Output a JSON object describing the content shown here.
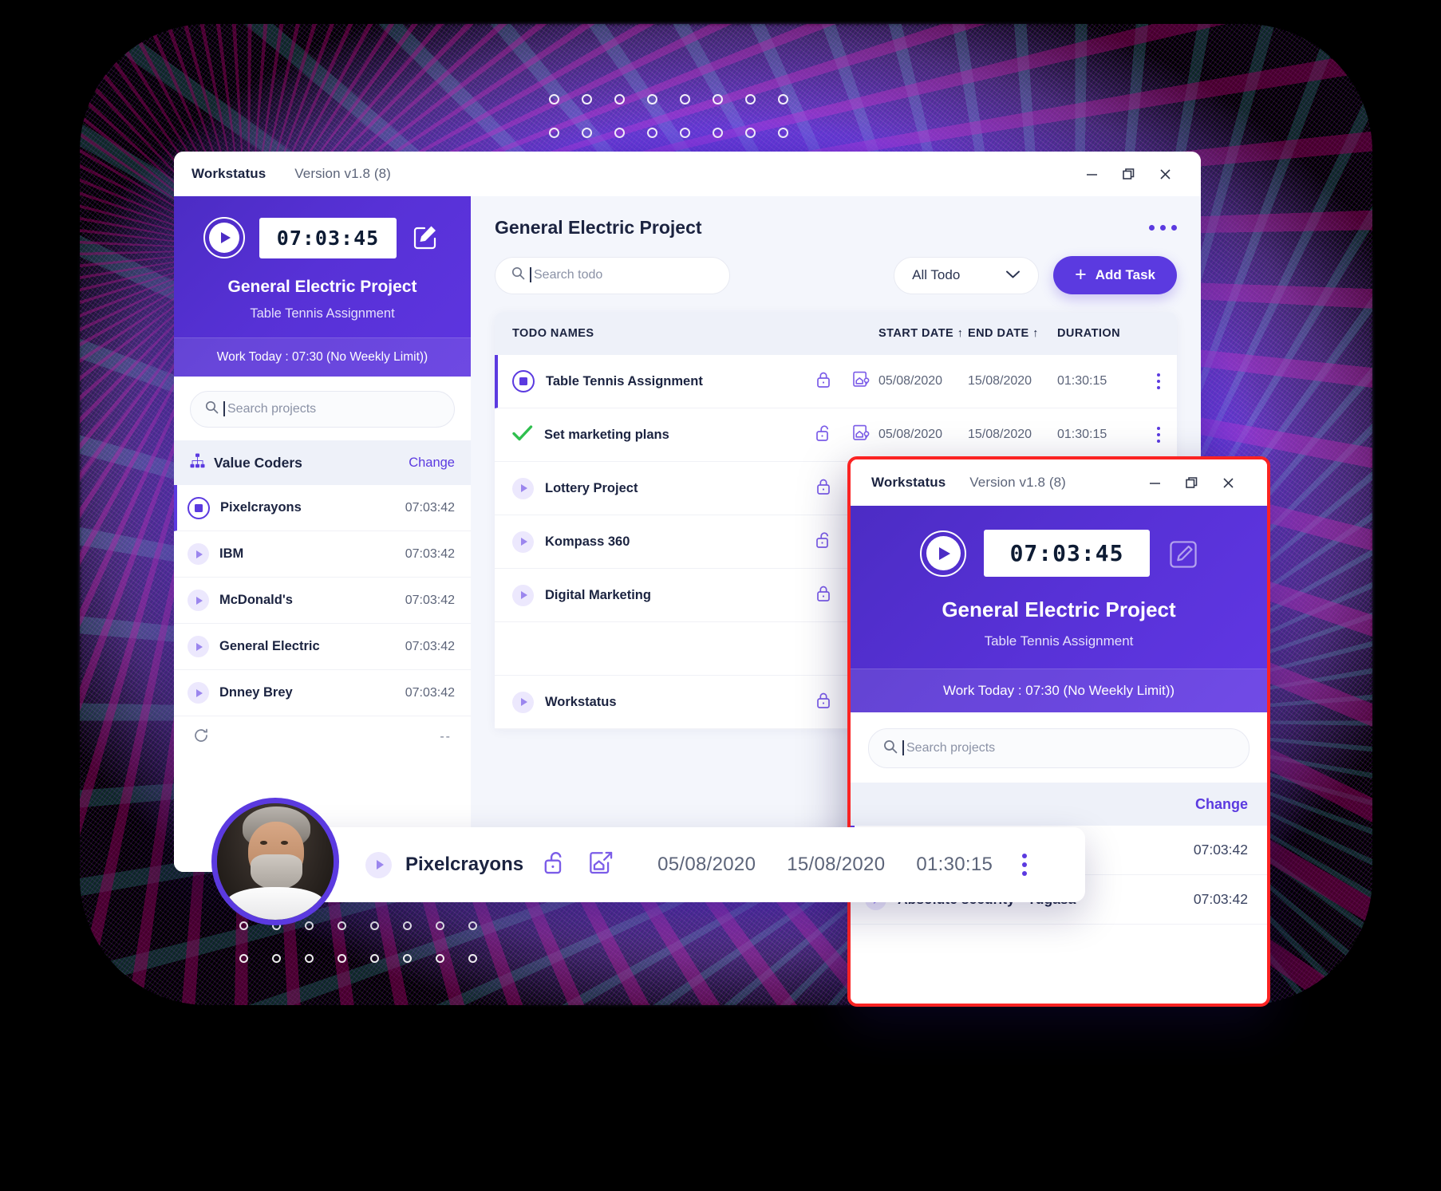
{
  "app": {
    "name": "Workstatus",
    "version": "Version v1.8 (8)"
  },
  "window_controls": {
    "minimize": "minimize-icon",
    "maximize": "restore-icon",
    "close": "close-icon"
  },
  "sidebar": {
    "timer": "07:03:45",
    "play_icon": "play-icon",
    "edit_icon": "edit-pencil-icon",
    "project_title": "General Electric Project",
    "task_subtitle": "Table Tennis Assignment",
    "work_today": "Work Today : 07:30 (No Weekly Limit))",
    "search_placeholder": "Search projects",
    "search_value": "",
    "group": {
      "icon": "org-chart-icon",
      "name": "Value Coders",
      "change_label": "Change"
    },
    "projects": [
      {
        "name": "Pixelcrayons",
        "time": "07:03:42",
        "state": "running",
        "icon": "stop-square-icon"
      },
      {
        "name": "IBM",
        "time": "07:03:42",
        "state": "idle",
        "icon": "play-icon"
      },
      {
        "name": "McDonald's",
        "time": "07:03:42",
        "state": "idle",
        "icon": "play-icon"
      },
      {
        "name": "General Electric",
        "time": "07:03:42",
        "state": "idle",
        "icon": "play-icon"
      },
      {
        "name": "Dnney Brey",
        "time": "07:03:42",
        "state": "idle",
        "icon": "play-icon"
      }
    ]
  },
  "content": {
    "page_title": "General Electric Project",
    "overflow_icon": "more-horizontal-icon",
    "search_placeholder": "Search todo",
    "search_value": "",
    "filter_selected": "All Todo",
    "filter_icon": "chevron-down-icon",
    "add_task_label": "Add Task",
    "add_task_icon": "plus-icon",
    "table": {
      "columns": [
        "TODO NAMES",
        "START DATE ↑",
        "END DATE ↑",
        "DURATION"
      ],
      "rows": [
        {
          "name": "Table Tennis Assignment",
          "status": "running",
          "status_icon": "stop-square-icon",
          "lock": "lock-closed-icon",
          "place": "house-pin-icon",
          "start": "05/08/2020",
          "end": "15/08/2020",
          "duration": "01:30:15",
          "menu": "kebab-menu-icon",
          "selected": true
        },
        {
          "name": "Set marketing plans",
          "status": "done",
          "status_icon": "check-icon",
          "lock": "lock-open-icon",
          "place": "house-pin-icon",
          "start": "05/08/2020",
          "end": "15/08/2020",
          "duration": "01:30:15",
          "menu": "kebab-menu-icon",
          "selected": false
        },
        {
          "name": "Lottery Project",
          "status": "idle",
          "status_icon": "play-icon",
          "lock": "lock-closed-icon",
          "place": "house-arrow-icon",
          "start": "",
          "end": "",
          "duration": "",
          "menu": "",
          "selected": false
        },
        {
          "name": "Kompass 360",
          "status": "idle",
          "status_icon": "play-icon",
          "lock": "lock-open-icon",
          "place": "house-pin-icon",
          "start": "",
          "end": "",
          "duration": "",
          "menu": "",
          "selected": false
        },
        {
          "name": "Digital Marketing",
          "status": "idle",
          "status_icon": "play-icon",
          "lock": "lock-closed-icon",
          "place": "house-arrow-icon",
          "start": "",
          "end": "",
          "duration": "",
          "menu": "",
          "selected": false
        },
        {
          "name": "",
          "status": "",
          "status_icon": "",
          "lock": "",
          "place": "",
          "start": "",
          "end": "",
          "duration": "",
          "menu": "",
          "selected": false
        },
        {
          "name": "Workstatus",
          "status": "idle",
          "status_icon": "play-icon",
          "lock": "lock-closed-icon",
          "place": "house-pin-icon",
          "start": "",
          "end": "",
          "duration": "",
          "menu": "",
          "selected": false
        }
      ]
    }
  },
  "mini_window": {
    "app_name": "Workstatus",
    "version": "Version v1.8 (8)",
    "timer": "07:03:45",
    "project_title": "General Electric Project",
    "task_subtitle": "Table Tennis Assignment",
    "work_today": "Work Today : 07:30 (No Weekly Limit))",
    "search_placeholder": "Search projects",
    "search_value": "",
    "change_label": "Change",
    "projects": [
      {
        "name": "",
        "time": "07:03:42",
        "state": "running"
      },
      {
        "name": "Absolute security - Yugasa",
        "time": "07:03:42",
        "state": "idle"
      }
    ]
  },
  "float_row": {
    "name": "Pixelcrayons",
    "play_icon": "play-icon",
    "lock_icon": "lock-open-icon",
    "place_icon": "house-arrow-icon",
    "start": "05/08/2020",
    "end": "15/08/2020",
    "duration": "01:30:15",
    "menu_icon": "kebab-menu-icon",
    "avatar": "user-avatar-photo"
  },
  "colors": {
    "brand_purple": "#5b3ae0",
    "hero_purple": "#4c2cc4",
    "accent_red": "#fb2323",
    "success_green": "#2fbf4e",
    "text_dark": "#1b2340",
    "text_muted": "#5c6479",
    "panel_bg": "#f4f6fc"
  }
}
